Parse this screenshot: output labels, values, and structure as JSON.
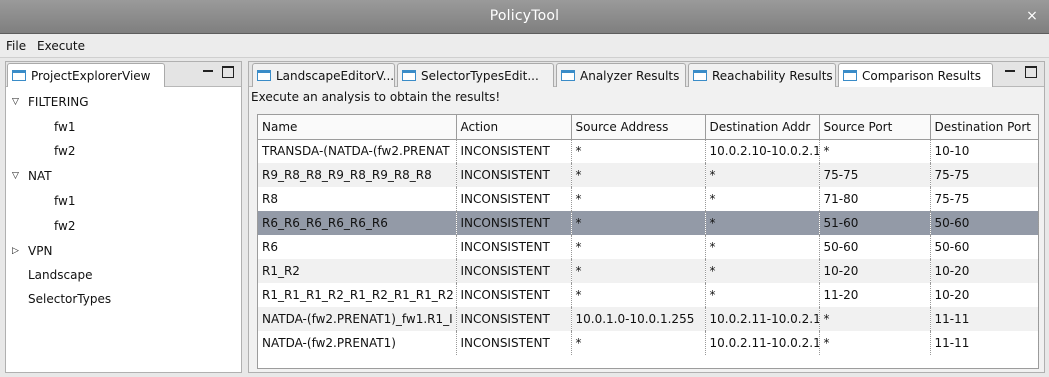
{
  "window": {
    "title": "PolicyTool",
    "close_glyph": "×"
  },
  "menubar": {
    "items": [
      "File",
      "Execute"
    ]
  },
  "left_view": {
    "tab_label": "ProjectExplorerView",
    "tree": [
      {
        "label": "FILTERING",
        "expander": "▽"
      },
      {
        "label": "fw1"
      },
      {
        "label": "fw2"
      },
      {
        "label": "NAT",
        "expander": "▽"
      },
      {
        "label": "fw1"
      },
      {
        "label": "fw2"
      },
      {
        "label": "VPN",
        "expander": "▷"
      },
      {
        "label": "Landscape"
      },
      {
        "label": "SelectorTypes"
      }
    ]
  },
  "right_view": {
    "tabs": [
      "LandscapeEditorV...",
      "SelectorTypesEdit...",
      "Analyzer Results",
      "Reachability Results",
      "Comparison Results"
    ],
    "active_tab_index": 4,
    "status_message": "Execute an analysis to obtain the results!",
    "table": {
      "columns": [
        "Name",
        "Action",
        "Source Address",
        "Destination Addr",
        "Source Port",
        "Destination Port"
      ],
      "selected_row_index": 3,
      "rows": [
        [
          "TRANSDA-(NATDA-(fw2.PRENAT",
          "INCONSISTENT",
          "*",
          "10.0.2.10-10.0.2.1",
          "*",
          "10-10"
        ],
        [
          "R9_R8_R8_R9_R8_R9_R8_R8",
          "INCONSISTENT",
          "*",
          "*",
          "75-75",
          "75-75"
        ],
        [
          "R8",
          "INCONSISTENT",
          "*",
          "*",
          "71-80",
          "75-75"
        ],
        [
          "R6_R6_R6_R6_R6_R6",
          "INCONSISTENT",
          "*",
          "*",
          "51-60",
          "50-60"
        ],
        [
          "R6",
          "INCONSISTENT",
          "*",
          "*",
          "50-60",
          "50-60"
        ],
        [
          "R1_R2",
          "INCONSISTENT",
          "*",
          "*",
          "10-20",
          "10-20"
        ],
        [
          "R1_R1_R1_R2_R1_R2_R1_R1_R2",
          "INCONSISTENT",
          "*",
          "*",
          "11-20",
          "10-20"
        ],
        [
          "NATDA-(fw2.PRENAT1)_fw1.R1_I",
          "INCONSISTENT",
          "10.0.1.0-10.0.1.255",
          "10.0.2.11-10.0.2.1",
          "*",
          "11-11"
        ],
        [
          "NATDA-(fw2.PRENAT1)",
          "INCONSISTENT",
          "*",
          "10.0.2.11-10.0.2.1",
          "*",
          "11-11"
        ]
      ]
    }
  }
}
